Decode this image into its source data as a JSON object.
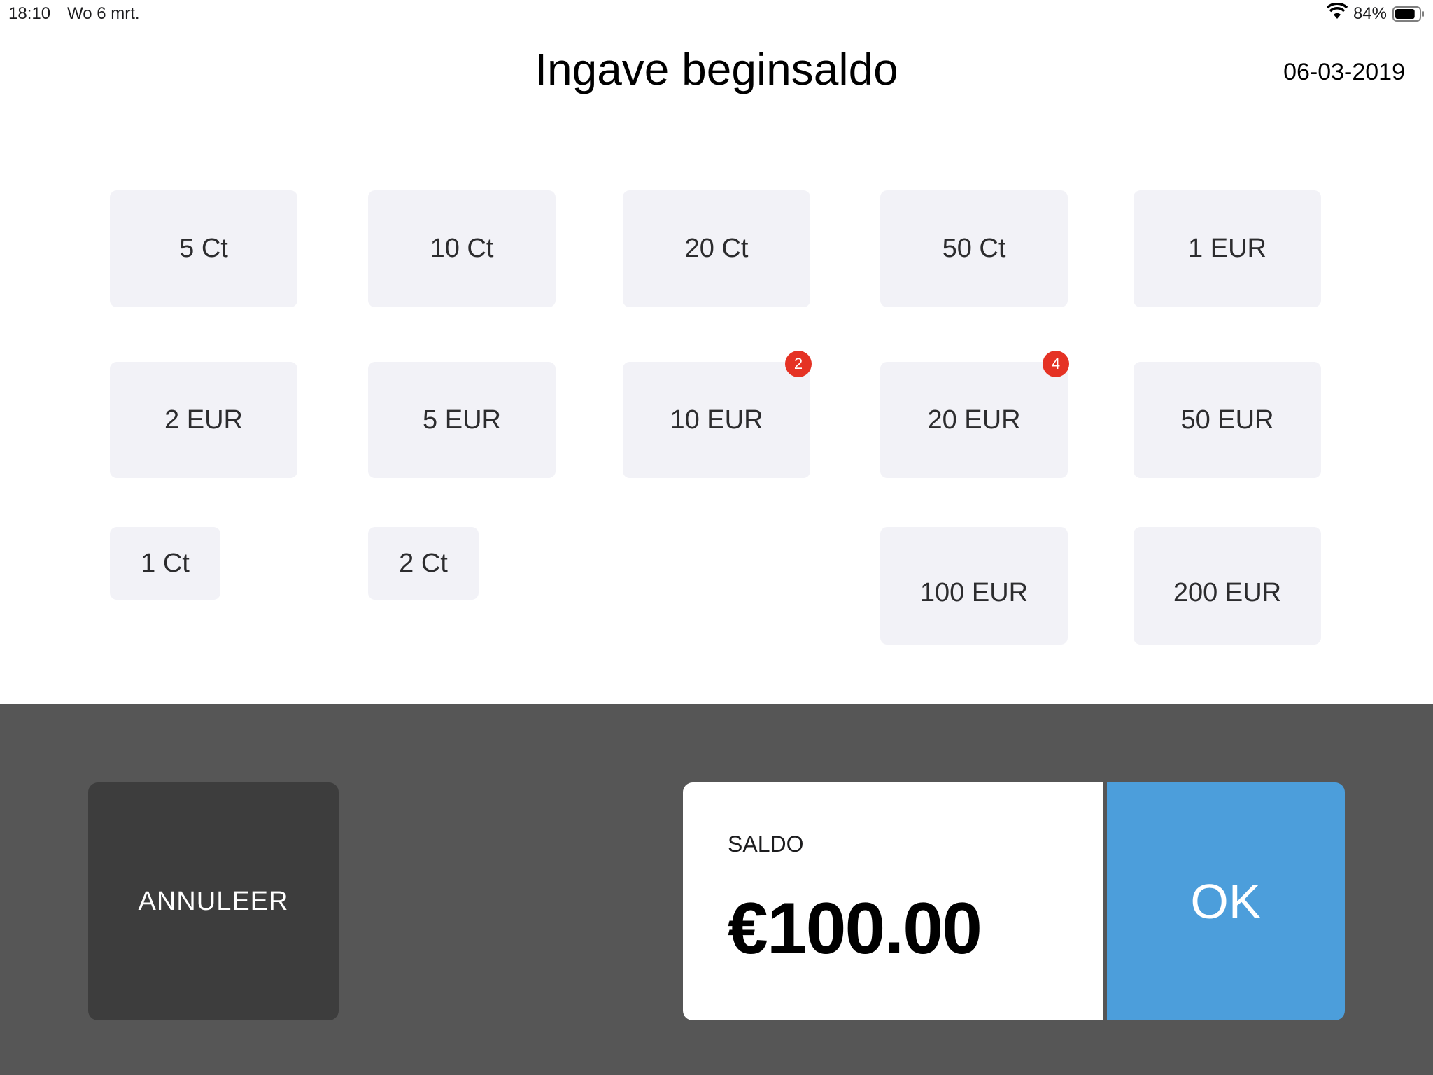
{
  "status_bar": {
    "time": "18:10",
    "date": "Wo 6 mrt.",
    "battery_text": "84%",
    "battery_level": 0.84,
    "wifi_icon": "wifi-icon",
    "battery_icon": "battery-icon"
  },
  "header": {
    "title": "Ingave beginsaldo",
    "date": "06-03-2019"
  },
  "denominations": [
    {
      "label": "5 Ct",
      "count": ""
    },
    {
      "label": "10 Ct",
      "count": ""
    },
    {
      "label": "20 Ct",
      "count": ""
    },
    {
      "label": "50 Ct",
      "count": ""
    },
    {
      "label": "1 EUR",
      "count": ""
    },
    {
      "label": "2 EUR",
      "count": ""
    },
    {
      "label": "5 EUR",
      "count": ""
    },
    {
      "label": "10 EUR",
      "count": "2"
    },
    {
      "label": "20 EUR",
      "count": "4"
    },
    {
      "label": "50 EUR",
      "count": ""
    },
    {
      "label": "1 Ct",
      "count": ""
    },
    {
      "label": "2 Ct",
      "count": ""
    },
    {
      "label": "100 EUR",
      "count": ""
    },
    {
      "label": "200 EUR",
      "count": ""
    }
  ],
  "footer": {
    "cancel_label": "ANNULEER",
    "saldo_label": "SALDO",
    "saldo_value": "€100.00",
    "ok_label": "OK"
  },
  "colors": {
    "tile_background": "#f2f2f7",
    "badge": "#e53224",
    "footer_background": "#565656",
    "cancel_background": "#3d3d3d",
    "ok_background": "#4c9edb"
  }
}
